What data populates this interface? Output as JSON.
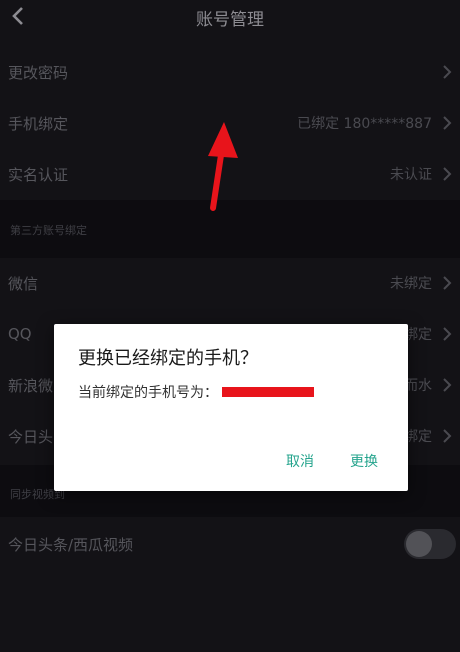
{
  "header": {
    "title": "账号管理"
  },
  "rows": [
    {
      "label": "更改密码",
      "value": ""
    },
    {
      "label": "手机绑定",
      "value": "已绑定 180*****887"
    },
    {
      "label": "实名认证",
      "value": "未认证"
    },
    {
      "label": "微信",
      "value": "未绑定"
    },
    {
      "label": "QQ",
      "value": "绑定"
    },
    {
      "label": "新浪微",
      "value": "而水"
    },
    {
      "label": "今日头",
      "value": "绑定"
    }
  ],
  "sections": {
    "third_party": "第三方账号绑定",
    "sync": "同步视频到"
  },
  "sync_row": {
    "label": "今日头条/西瓜视频"
  },
  "dialog": {
    "title": "更换已经绑定的手机？",
    "message": "当前绑定的手机号为：",
    "cancel": "取消",
    "confirm": "更换"
  },
  "colors": {
    "accent": "#25a48d",
    "redaction": "#e8141b",
    "annotation_arrow": "#e8141b"
  }
}
